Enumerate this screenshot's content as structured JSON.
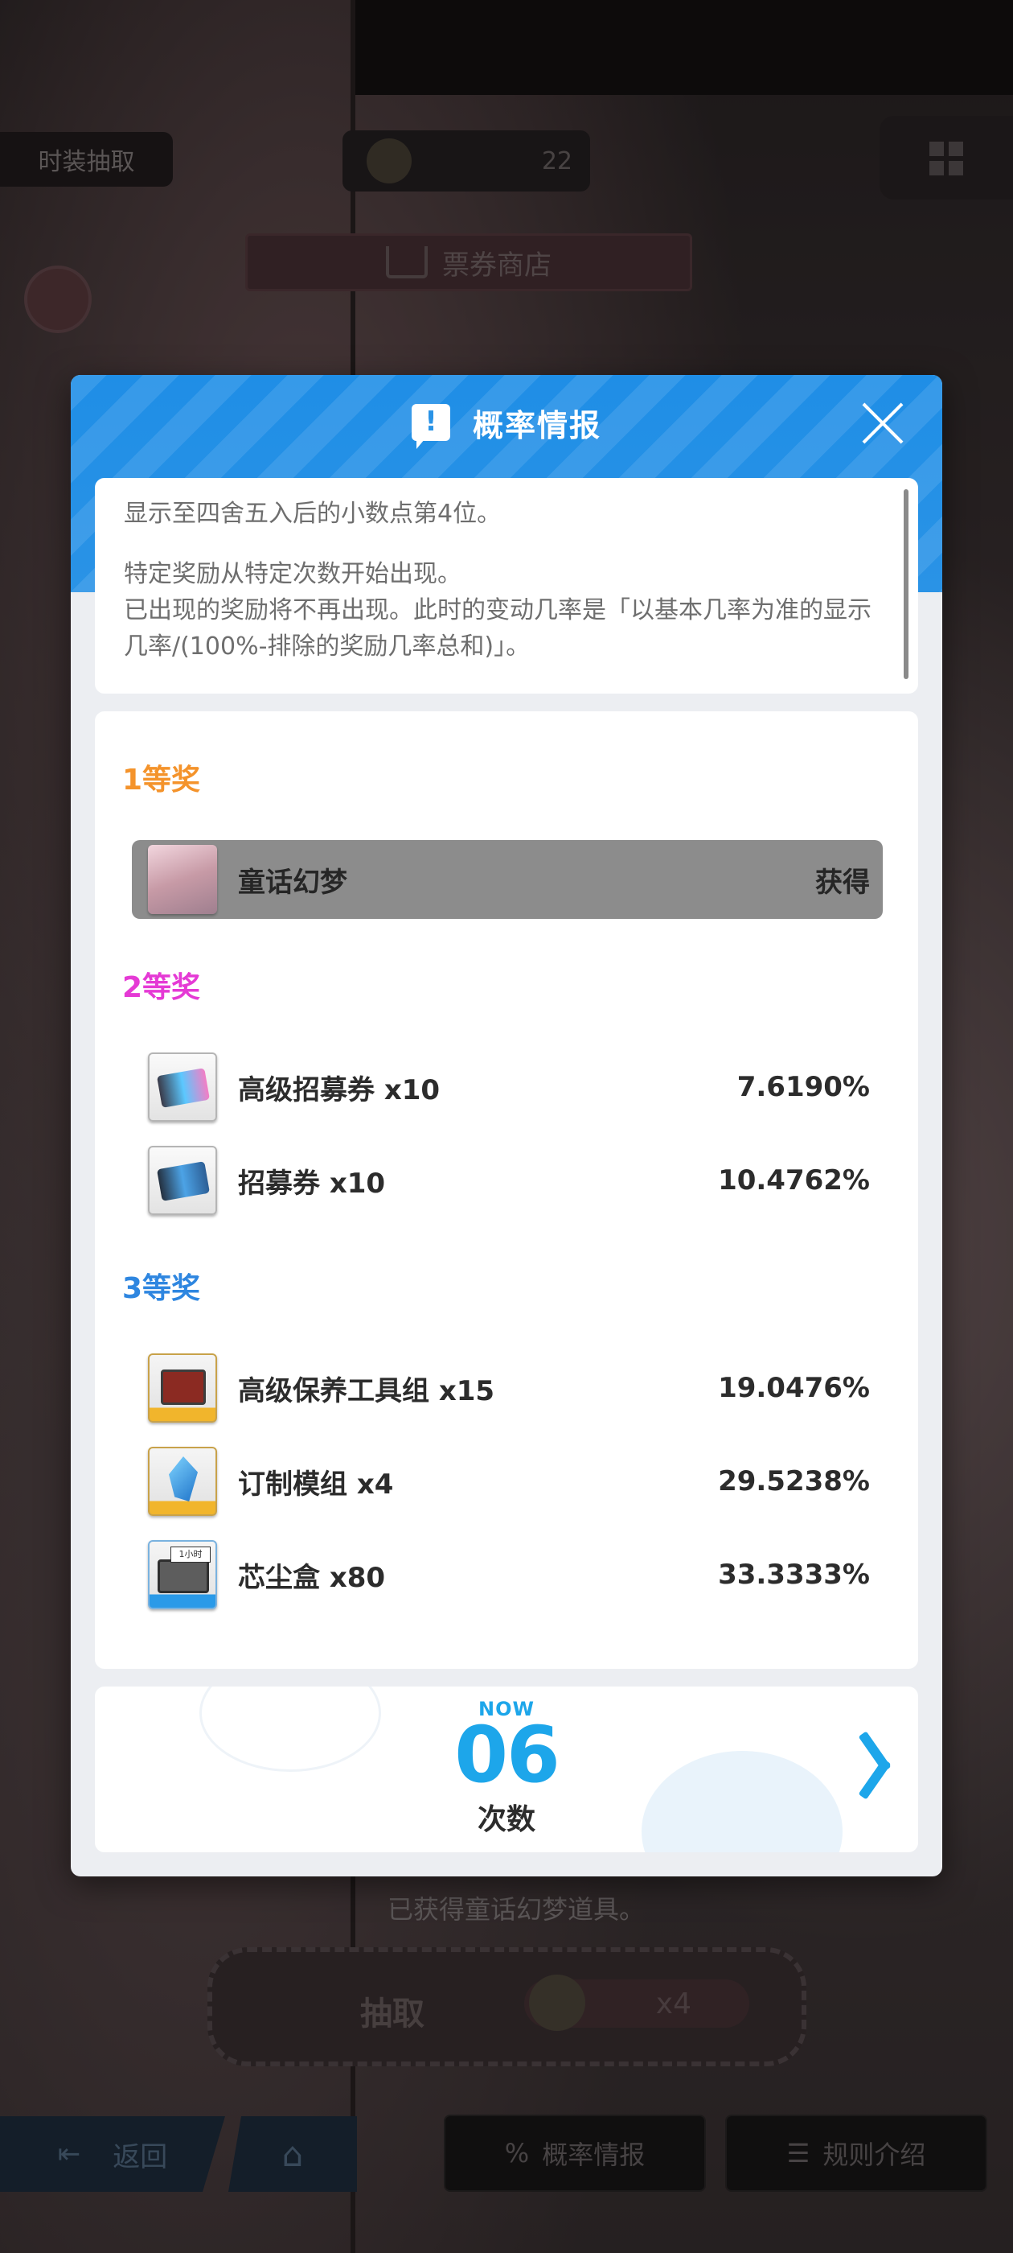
{
  "background": {
    "left_chip": "时装抽取",
    "currency_count": "22",
    "shop_label": "票券商店",
    "notice": "已获得童话幻梦道具。",
    "draw_label": "抽取",
    "draw_cost": "x4",
    "back_label": "返回",
    "rate_button": "概率情报",
    "rules_button": "规则介绍"
  },
  "modal": {
    "title": "概率情报",
    "notes": [
      "显示至四舍五入后的小数点第4位。",
      "特定奖励从特定次数开始出现。",
      "已出现的奖励将不再出现。此时的变动几率是「以基本几率为准的显示几率/(100%-排除的奖励几率总和)」。"
    ],
    "tiers": [
      {
        "label": "1等奖",
        "color": "#f4932b",
        "items": [
          {
            "name": "童话幻梦",
            "rate": "获得",
            "obtained": true
          }
        ]
      },
      {
        "label": "2等奖",
        "color": "#e53ad5",
        "items": [
          {
            "name": "高级招募券 x10",
            "rate": "7.6190%"
          },
          {
            "name": "招募券 x10",
            "rate": "10.4762%"
          }
        ]
      },
      {
        "label": "3等奖",
        "color": "#2e86e0",
        "items": [
          {
            "name": "高级保养工具组 x15",
            "rate": "19.0476%"
          },
          {
            "name": "订制模组 x4",
            "rate": "29.5238%"
          },
          {
            "name": "芯尘盒 x80",
            "rate": "33.3333%"
          }
        ]
      }
    ],
    "counter": {
      "now_label": "NOW",
      "value": "06",
      "caption": "次数",
      "item_tag": "1小时"
    }
  },
  "colors": {
    "header_blue": "#2a93e6",
    "accent_cyan": "#1da6ea"
  }
}
